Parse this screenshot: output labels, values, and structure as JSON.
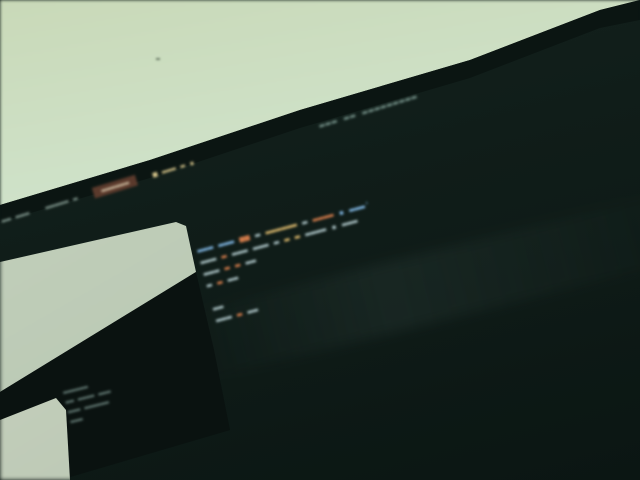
{
  "photo": {
    "subject": "blurred photo of a monitor showing a dark code editor",
    "colors": {
      "wall": "#cfe2c9",
      "screen": "#101d19",
      "tab_highlight": "#5b3a2c",
      "keyword": "#d07a4a",
      "string": "#d6b46a",
      "function": "#7fb4e0"
    }
  }
}
